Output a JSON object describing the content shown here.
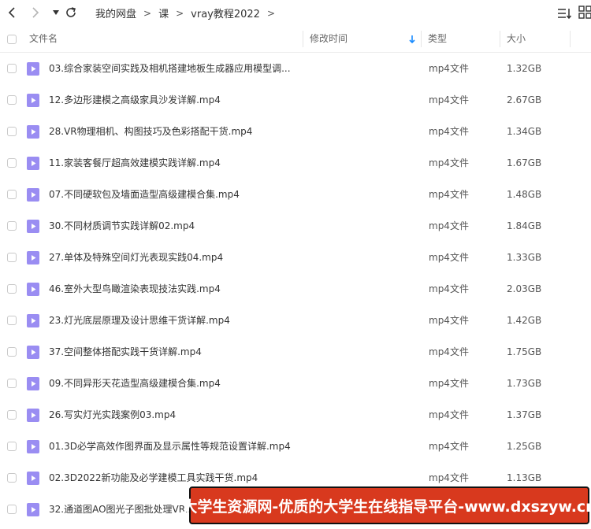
{
  "breadcrumb": [
    "我的网盘",
    "课",
    "vray教程2022"
  ],
  "columns": {
    "name": "文件名",
    "modified": "修改时间",
    "type": "类型",
    "size": "大小"
  },
  "files": [
    {
      "name": "03.综合家装空间实践及相机搭建地板生成器应用模型调...",
      "type": "mp4文件",
      "size": "1.32GB"
    },
    {
      "name": "12.多边形建模之高级家具沙发详解.mp4",
      "type": "mp4文件",
      "size": "2.67GB"
    },
    {
      "name": "28.VR物理相机、构图技巧及色彩搭配干货.mp4",
      "type": "mp4文件",
      "size": "1.34GB"
    },
    {
      "name": "11.家装客餐厅超高效建模实践详解.mp4",
      "type": "mp4文件",
      "size": "1.67GB"
    },
    {
      "name": "07.不同硬软包及墙面造型高级建模合集.mp4",
      "type": "mp4文件",
      "size": "1.48GB"
    },
    {
      "name": "30.不同材质调节实践详解02.mp4",
      "type": "mp4文件",
      "size": "1.84GB"
    },
    {
      "name": "27.单体及特殊空间灯光表现实践04.mp4",
      "type": "mp4文件",
      "size": "1.33GB"
    },
    {
      "name": "46.室外大型鸟瞰渲染表现技法实践.mp4",
      "type": "mp4文件",
      "size": "2.03GB"
    },
    {
      "name": "23.灯光底层原理及设计思维干货详解.mp4",
      "type": "mp4文件",
      "size": "1.42GB"
    },
    {
      "name": "37.空间整体搭配实践干货详解.mp4",
      "type": "mp4文件",
      "size": "1.75GB"
    },
    {
      "name": "09.不同异形天花造型高级建模合集.mp4",
      "type": "mp4文件",
      "size": "1.73GB"
    },
    {
      "name": "26.写实灯光实践案例03.mp4",
      "type": "mp4文件",
      "size": "1.37GB"
    },
    {
      "name": "01.3D必学高效作图界面及显示属性等规范设置详解.mp4",
      "type": "mp4文件",
      "size": "1.25GB"
    },
    {
      "name": "02.3D2022新功能及必学建模工具实践干货.mp4",
      "type": "mp4文件",
      "size": "1.13GB"
    },
    {
      "name": "32.通道图AO图光子图批处理VR...",
      "type": "",
      "size": ""
    }
  ],
  "banner": {
    "text": "大学生资源网-优质的大学生在线指导平台-www.dxszyw.cn"
  },
  "colors": {
    "accent": "#1a8cff",
    "file_icon": "#9a8df2",
    "banner_bg": "#d8391e"
  }
}
